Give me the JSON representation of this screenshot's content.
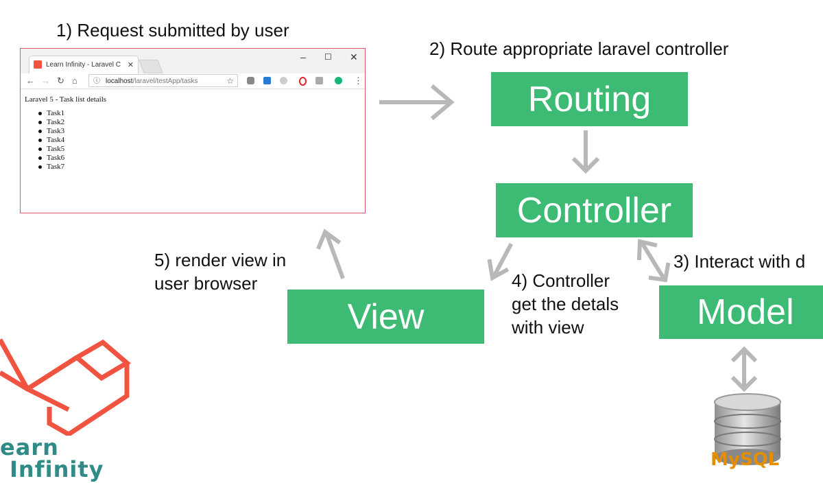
{
  "steps": {
    "request": "1) Request submitted by user",
    "route": "2) Route appropriate laravel controller",
    "interact": "3) Interact with d",
    "details_line1": "4) Controller",
    "details_line2": "get the detals",
    "details_line3": "with view",
    "render_line1": "5) render view in",
    "render_line2": "user browser"
  },
  "boxes": {
    "routing": "Routing",
    "controller": "Controller",
    "view": "View",
    "model": "Model"
  },
  "browser": {
    "tab_title": "Learn Infinity - Laravel C",
    "url_host": "localhost",
    "url_path": "/laravel/testApp/tasks",
    "page_heading": "Laravel 5 - Task list details",
    "tasks": [
      "Task1",
      "Task2",
      "Task3",
      "Task4",
      "Task5",
      "Task6",
      "Task7"
    ]
  },
  "logos": {
    "learn_infinity_line1": "earn",
    "learn_infinity_line2": "Infinity",
    "mysql": "MySQL"
  },
  "colors": {
    "box_green": "#3dba74",
    "arrow_gray": "#b8b8b8",
    "laravel_red": "#f05340",
    "logo_teal": "#2e8b86"
  }
}
